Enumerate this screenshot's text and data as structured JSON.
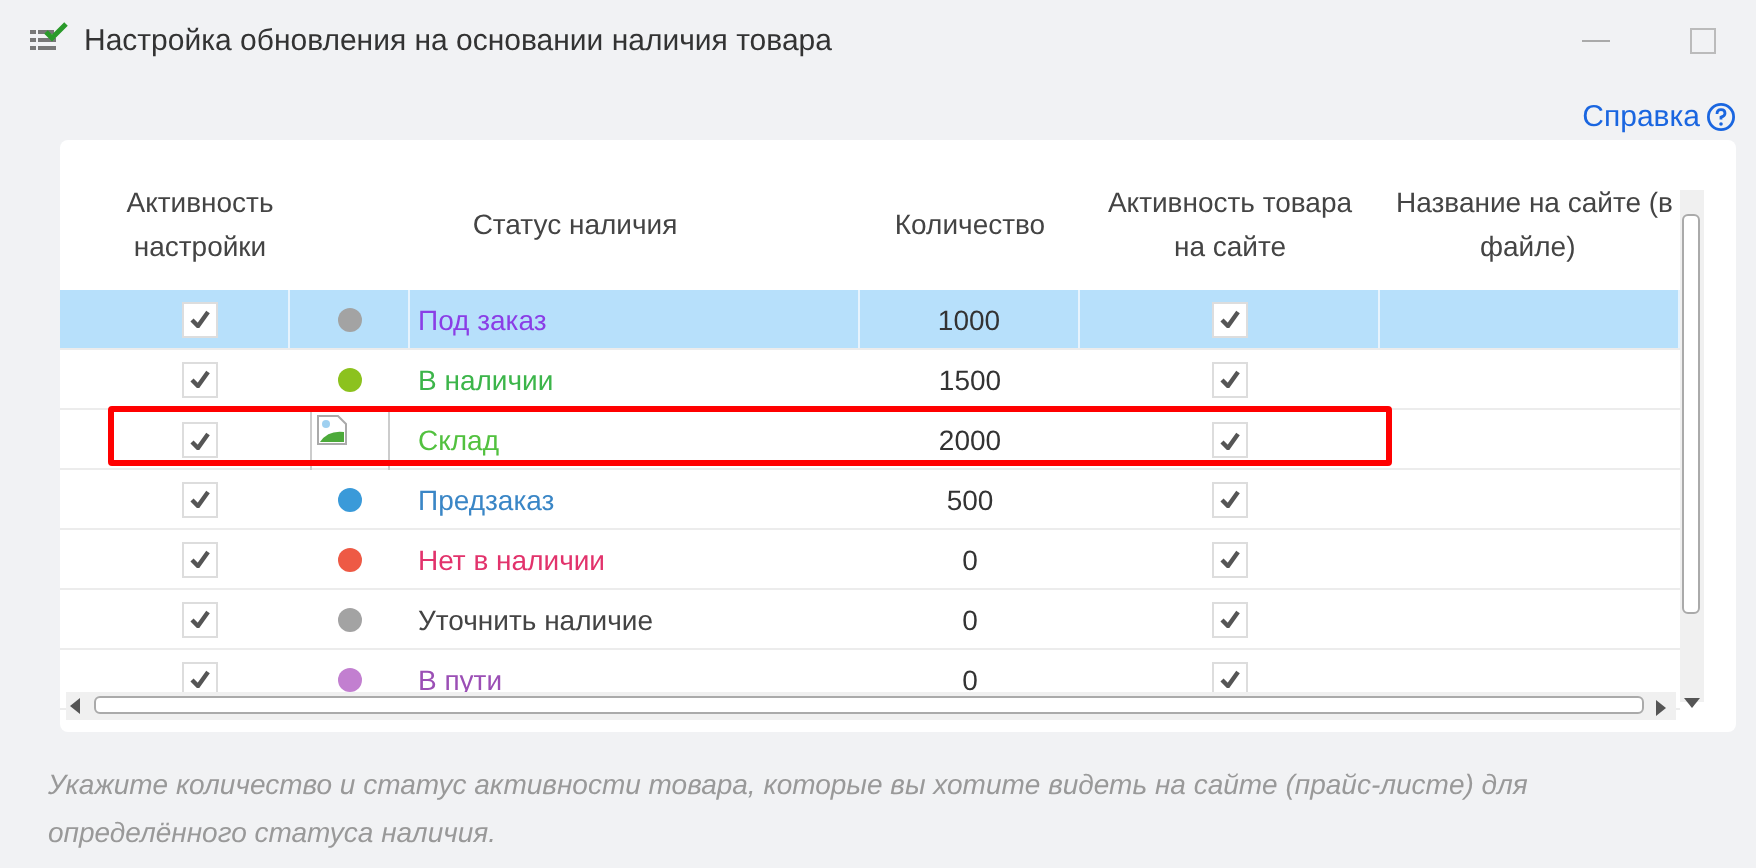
{
  "window": {
    "title": "Настройка обновления на основании наличия товара"
  },
  "help_link": "Справка",
  "table": {
    "columns": [
      {
        "label": "Активность настройки"
      },
      {
        "label": "Статус наличия"
      },
      {
        "label": "Количество"
      },
      {
        "label": "Активность товара на сайте"
      },
      {
        "label": "Название на сайте (в файле)"
      }
    ],
    "rows": [
      {
        "active": true,
        "kind": "dot",
        "dot": {
          "color": "#a3a3a3"
        },
        "status": {
          "text": "Под заказ",
          "color": "#8a3ee6"
        },
        "quantity": "1000",
        "site_active": true,
        "selected": true,
        "highlighted": false
      },
      {
        "active": true,
        "kind": "dot",
        "dot": {
          "color": "#8cc21e"
        },
        "status": {
          "text": "В наличии",
          "color": "#3cb54a"
        },
        "quantity": "1500",
        "site_active": true,
        "selected": false,
        "highlighted": false
      },
      {
        "active": true,
        "kind": "broken-image",
        "status": {
          "text": "Склад",
          "color": "#52c13f"
        },
        "quantity": "2000",
        "site_active": true,
        "selected": false,
        "highlighted": true
      },
      {
        "active": true,
        "kind": "dot",
        "dot": {
          "color": "#3a9ad9"
        },
        "status": {
          "text": "Предзаказ",
          "color": "#3a86c6"
        },
        "quantity": "500",
        "site_active": true,
        "selected": false,
        "highlighted": false
      },
      {
        "active": true,
        "kind": "dot",
        "dot": {
          "color": "#ee5a45"
        },
        "status": {
          "text": "Нет в наличии",
          "color": "#e2336c"
        },
        "quantity": "0",
        "site_active": true,
        "selected": false,
        "highlighted": false
      },
      {
        "active": true,
        "kind": "dot",
        "dot": {
          "color": "#a3a3a3"
        },
        "status": {
          "text": "Уточнить наличие",
          "color": "#444444"
        },
        "quantity": "0",
        "site_active": true,
        "selected": false,
        "highlighted": false
      },
      {
        "active": true,
        "kind": "dot",
        "dot": {
          "color": "#c27fd0"
        },
        "status": {
          "text": "В пути",
          "color": "#9b4fb5"
        },
        "quantity": "0",
        "site_active": true,
        "selected": false,
        "highlighted": false
      }
    ]
  },
  "hint": "Укажите количество и статус активности товара, которые вы хотите видеть на сайте (прайс-листе) для определённого статуса наличия."
}
